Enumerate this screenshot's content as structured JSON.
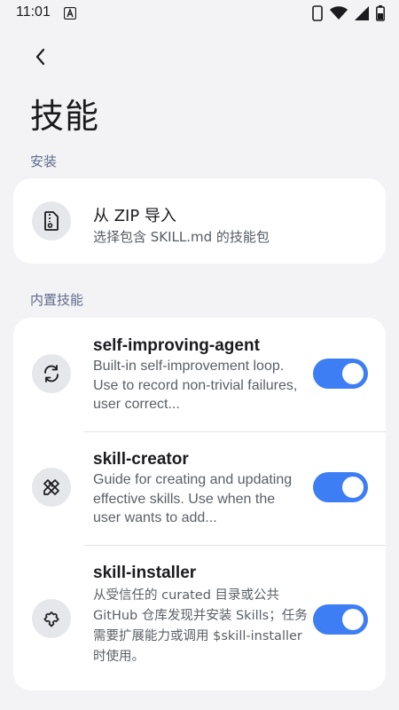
{
  "status_bar": {
    "time": "11:01",
    "icons": [
      "notification-a-icon",
      "phone-icon",
      "wifi-icon",
      "signal-icon",
      "battery-icon"
    ]
  },
  "header": {
    "back_icon": "chevron-left-icon",
    "title": "技能"
  },
  "install_section": {
    "label": "安装",
    "items": [
      {
        "icon": "zip-file-icon",
        "title": "从 ZIP 导入",
        "subtitle": "选择包含 SKILL.md 的技能包"
      }
    ]
  },
  "builtin_section": {
    "label": "内置技能",
    "skills": [
      {
        "icon": "sync-icon",
        "name": "self-improving-agent",
        "description": "Built-in self-improvement loop. Use to record non-trivial failures, user correct...",
        "enabled": true
      },
      {
        "icon": "pencil-ruler-icon",
        "name": "skill-creator",
        "description": "Guide for creating and updating effective skills. Use when the user wants to add...",
        "enabled": true
      },
      {
        "icon": "puzzle-icon",
        "name": "skill-installer",
        "description": "从受信任的 curated 目录或公共 GitHub 仓库发现并安装 Skills；任务需要扩展能力或调用 $skill-installer 时使用。",
        "enabled": true
      }
    ]
  },
  "colors": {
    "background": "#f3f3f5",
    "card": "#ffffff",
    "accent": "#3d7ef5",
    "section_label": "#5d6b8c"
  }
}
